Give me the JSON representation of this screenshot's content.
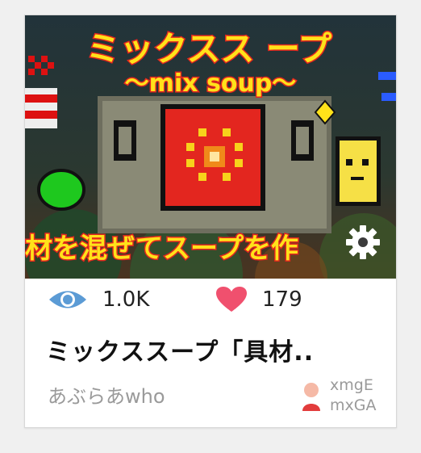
{
  "card": {
    "thumbnail": {
      "title_text": "ミックスス ープ",
      "subtitle_text": "〜mix soup〜",
      "banner_text": "材を混ぜてスープを作"
    },
    "stats": {
      "views_icon": "eye-icon",
      "views": "1.0K",
      "likes_icon": "heart-icon",
      "likes": "179"
    },
    "title": "ミックススープ「具材..",
    "author": "あぶらあwho",
    "user": {
      "icon": "user-icon",
      "handle_line1": "xmgE",
      "handle_line2": "mxGA"
    }
  },
  "colors": {
    "eye": "#5b9bd5",
    "heart": "#f0506e",
    "title_yellow": "#ffe21a",
    "outline_red": "#e3261f",
    "subtle": "#9a9a9a"
  }
}
